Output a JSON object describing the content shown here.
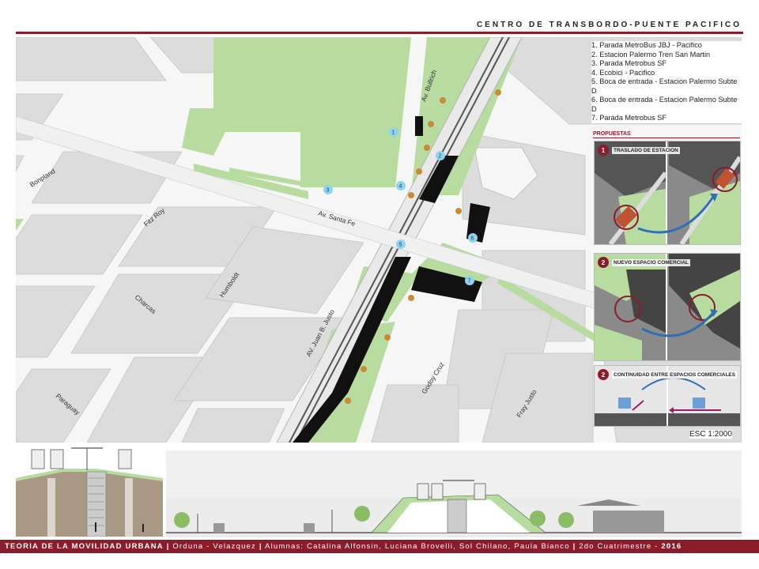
{
  "header": {
    "title": "CENTRO DE TRANSBORDO-PUENTE PACIFICO"
  },
  "legend": {
    "items": [
      "1. Parada MetroBus JBJ - Pacifico",
      "2. Estacion Palermo Tren San Martin",
      "3. Parada Metrobus SF",
      "4. Ecobici - Pacifico",
      "5. Boca de entrada - Estacion Palermo Subte D",
      "6. Boca de entrada - Estacion Palermo Subte D",
      "7. Parada Metrobus SF"
    ]
  },
  "streets": {
    "bonpland": "Bonpland",
    "fitz_roy": "Fitz Roy",
    "humboldt": "Humboldt",
    "charcas": "Charcas",
    "paraguay": "Paraguay",
    "av_juan_b_justo": "AV. Juan B. Justo",
    "av_santa_fe": "Av. Santa Fe",
    "av_bullrich": "Av. Bullrich",
    "godoy_cruz": "Godoy Cruz",
    "fray_justo": "Fray Justo"
  },
  "markers": [
    "1",
    "2",
    "3",
    "4",
    "5",
    "6",
    "7"
  ],
  "proposals": {
    "heading": "PROPUESTAS",
    "panels": [
      {
        "number": "1",
        "label": "TRASLADO DE ESTACION"
      },
      {
        "number": "2",
        "label": "NUEVO ESPACIO COMERCIAL"
      },
      {
        "number": "2",
        "label": "CONTINUIDAD ENTRE ESPACIOS COMERCIALES"
      }
    ]
  },
  "scale": "ESC 1:2000",
  "footer": {
    "course": "TEORIA DE LA MOVILIDAD URBANA",
    "sep": "|",
    "authors": "Orduna - Velazquez",
    "students": "Alumnas: Catalina Alfonsin, Luciana Brovelli, Sol Chilano, Paula Bianco",
    "term": "2do Cuatrimestre - ",
    "year": "2016"
  },
  "colors": {
    "accent": "#8a1c2c",
    "green": "#b8dca0",
    "block": "#dcdcdc",
    "street": "#f6f6f6",
    "rail": "#555555",
    "marker": "#8fd3ee"
  }
}
